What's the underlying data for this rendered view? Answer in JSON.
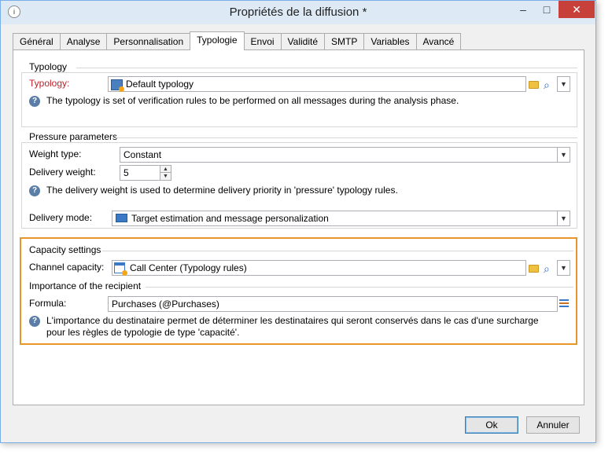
{
  "window": {
    "title": "Propriétés de la diffusion *",
    "minimize": "–",
    "maximize": "□",
    "close": "✕",
    "app_icon": "i"
  },
  "tabs": [
    "Général",
    "Analyse",
    "Personnalisation",
    "Typologie",
    "Envoi",
    "Validité",
    "SMTP",
    "Variables",
    "Avancé"
  ],
  "active_tab": "Typologie",
  "typology_group": {
    "title": "Typology",
    "label": "Typology:",
    "value": "Default typology",
    "info": "The typology is set of verification rules to be performed on all messages during the analysis phase."
  },
  "pressure_group": {
    "title": "Pressure parameters",
    "weight_type_label": "Weight type:",
    "weight_type_value": "Constant",
    "delivery_weight_label": "Delivery weight:",
    "delivery_weight_value": "5",
    "info": "The delivery weight is used to determine delivery priority in 'pressure' typology rules.",
    "delivery_mode_label": "Delivery mode:",
    "delivery_mode_value": "Target estimation and message personalization"
  },
  "capacity_group": {
    "title": "Capacity settings",
    "channel_capacity_label": "Channel capacity:",
    "channel_capacity_value": "Call Center (Typology rules)",
    "importance_title": "Importance of the recipient",
    "formula_label": "Formula:",
    "formula_value": "Purchases (@Purchases)",
    "info_line1": "L'importance du destinataire permet de déterminer les destinataires qui seront conservés dans le cas d'une surcharge",
    "info_line2": "pour les règles de typologie de type 'capacité'."
  },
  "buttons": {
    "ok": "Ok",
    "cancel": "Annuler"
  },
  "colors": {
    "highlight": "#e8962a",
    "required_label": "#c0202a",
    "close_button": "#c7403a"
  },
  "icons": {
    "info": "?",
    "search": "⌕",
    "dropdown": "▼",
    "spin_up": "▲",
    "spin_down": "▼"
  }
}
